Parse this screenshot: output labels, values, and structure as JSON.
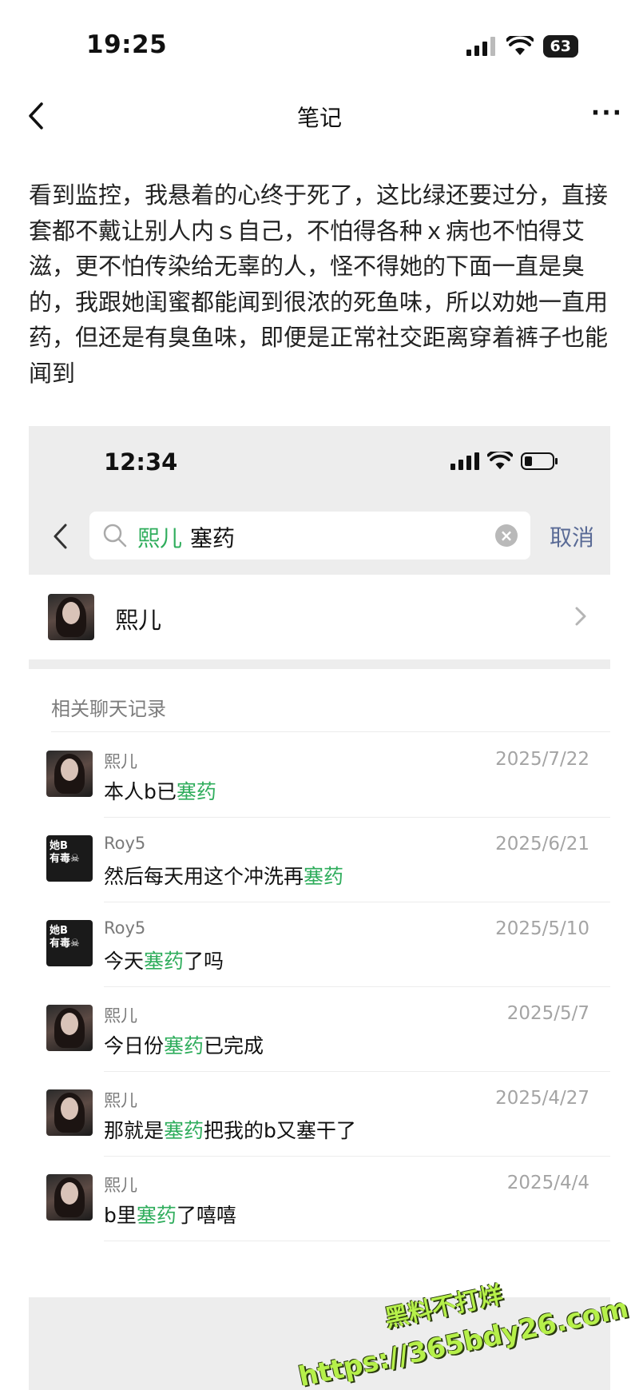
{
  "status_bar": {
    "time": "19:25",
    "battery": "63"
  },
  "nav": {
    "title": "笔记",
    "more": "···"
  },
  "note": {
    "body": "看到监控，我悬着的心终于死了，这比绿还要过分，直接套都不戴让别人内ｓ自己，不怕得各种ｘ病也不怕得艾滋，更不怕传染给无辜的人，怪不得她的下面一直是臭的，我跟她闺蜜都能闻到很浓的死鱼味，所以劝她一直用药，但还是有臭鱼味，即便是正常社交距离穿着裤子也能闻到"
  },
  "inner": {
    "status_time": "12:34",
    "search": {
      "query_name": "熙儿",
      "query_term": "塞药",
      "clear_icon": "×",
      "cancel": "取消"
    },
    "contact": {
      "name": "熙儿"
    },
    "section_title": "相关聊天记录",
    "results": [
      {
        "name": "熙儿",
        "date": "2025/7/22",
        "pre": "本人b已",
        "hl": "塞药",
        "post": "",
        "avatar": "photo"
      },
      {
        "name": "Roy5",
        "date": "2025/6/21",
        "pre": "然后每天用这个冲洗再",
        "hl": "塞药",
        "post": "",
        "avatar": "text"
      },
      {
        "name": "Roy5",
        "date": "2025/5/10",
        "pre": "今天",
        "hl": "塞药",
        "post": "了吗",
        "avatar": "text"
      },
      {
        "name": "熙儿",
        "date": "2025/5/7",
        "pre": "今日份",
        "hl": "塞药",
        "post": "已完成",
        "avatar": "photo"
      },
      {
        "name": "熙儿",
        "date": "2025/4/27",
        "pre": "那就是",
        "hl": "塞药",
        "post": "把我的b又塞干了",
        "avatar": "photo"
      },
      {
        "name": "熙儿",
        "date": "2025/4/4",
        "pre": "b里",
        "hl": "塞药",
        "post": "了嘻嘻",
        "avatar": "photo"
      }
    ],
    "text_avatar": {
      "line1": "她B",
      "line2": "有毒☠"
    }
  },
  "watermark": {
    "line1": "黑料不打烊",
    "line2": "https://365bdy26.com"
  },
  "colors": {
    "highlight": "#2fad5c",
    "cancel": "#5a6b96",
    "header_bg": "#ededed"
  }
}
